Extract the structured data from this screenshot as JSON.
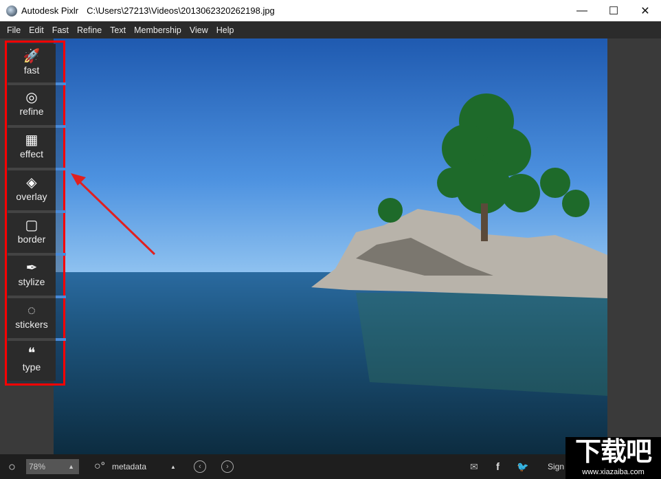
{
  "window": {
    "app_name": "Autodesk Pixlr",
    "file_path": "C:\\Users\\27213\\Videos\\2013062320262198.jpg",
    "minimize": "—",
    "maximize": "☐",
    "close": "✕"
  },
  "menu": [
    "File",
    "Edit",
    "Fast",
    "Refine",
    "Text",
    "Membership",
    "View",
    "Help"
  ],
  "tools": [
    {
      "label": "fast",
      "icon": "rocket-icon",
      "glyph": "🚀"
    },
    {
      "label": "refine",
      "icon": "refine-icon",
      "glyph": "◎"
    },
    {
      "label": "effect",
      "icon": "film-icon",
      "glyph": "▦"
    },
    {
      "label": "overlay",
      "icon": "layers-icon",
      "glyph": "◈"
    },
    {
      "label": "border",
      "icon": "border-icon",
      "glyph": "▢"
    },
    {
      "label": "stylize",
      "icon": "feather-icon",
      "glyph": "✒"
    },
    {
      "label": "stickers",
      "icon": "sticker-icon",
      "glyph": "◌"
    },
    {
      "label": "type",
      "icon": "quote-icon",
      "glyph": "❝"
    }
  ],
  "bottom": {
    "zoom_value": "78%",
    "metadata_label": "metadata",
    "sign_label": "Sign"
  },
  "watermark": {
    "big": "下载吧",
    "small": "www.xiazaiba.com"
  },
  "colors": {
    "highlight_border": "#ff0000",
    "annotation_arrow": "#e02020",
    "accent": "#4a8ad8"
  }
}
